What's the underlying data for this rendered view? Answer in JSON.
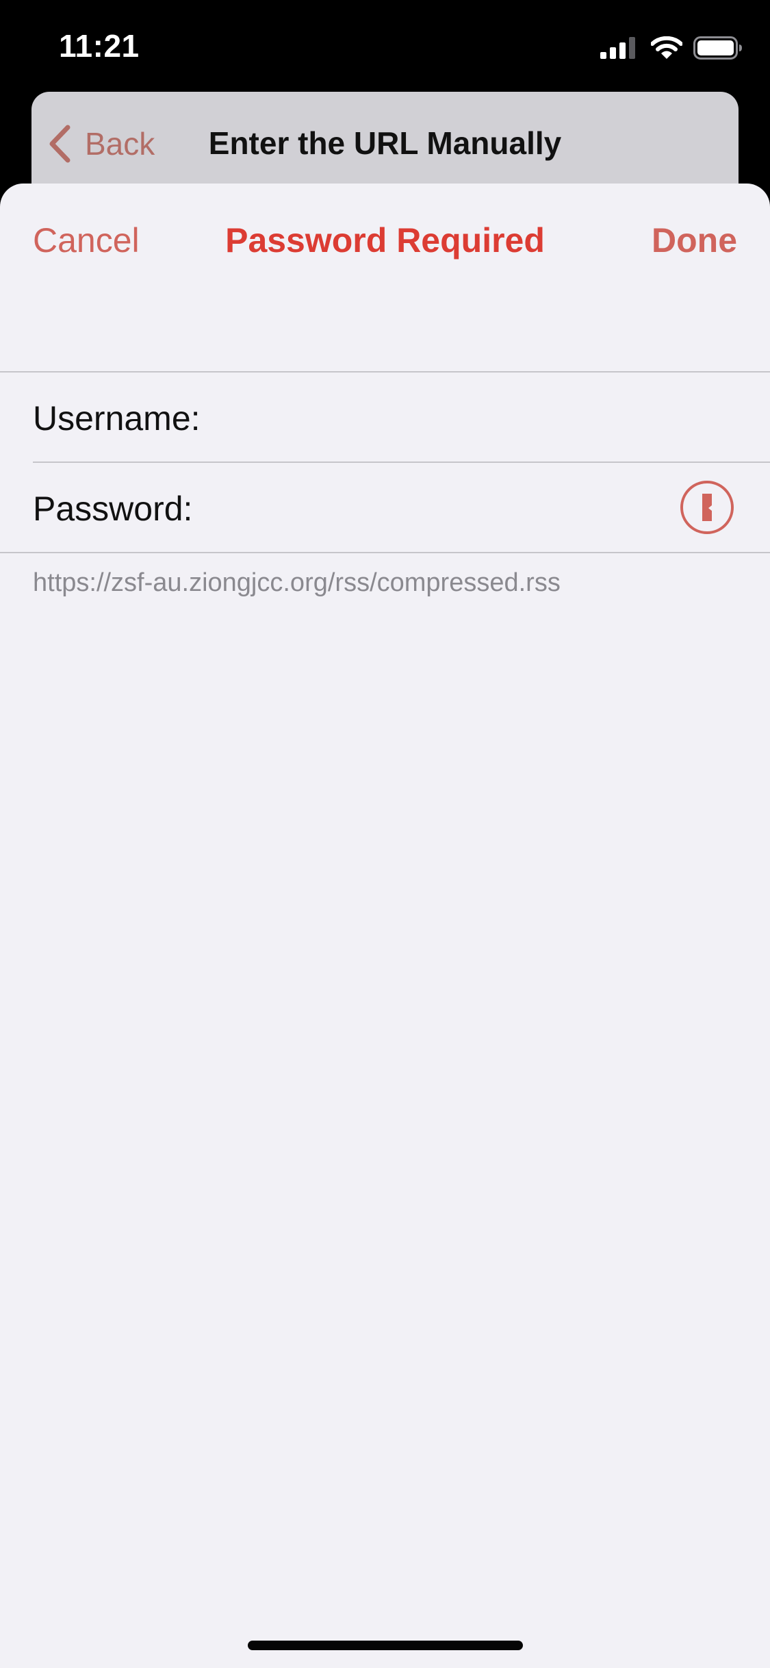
{
  "status_bar": {
    "time": "11:21",
    "icons": [
      "cellular-signal-icon",
      "wifi-icon",
      "battery-icon"
    ]
  },
  "background_nav": {
    "back_label": "Back",
    "title": "Enter the URL Manually"
  },
  "sheet": {
    "cancel_label": "Cancel",
    "title": "Password Required",
    "done_label": "Done",
    "username_label": "Username:",
    "username_value": "",
    "password_label": "Password:",
    "password_value": "",
    "password_manager_icon": "password-manager-keyhole-icon",
    "url": "https://zsf-au.ziongjcc.org/rss/compressed.rss"
  },
  "colors": {
    "accent": "#d0645c",
    "title_accent": "#dc3c33",
    "sheet_background": "#f2f1f6",
    "status_bar_background": "#000000",
    "secondary_text": "#8a898f"
  }
}
